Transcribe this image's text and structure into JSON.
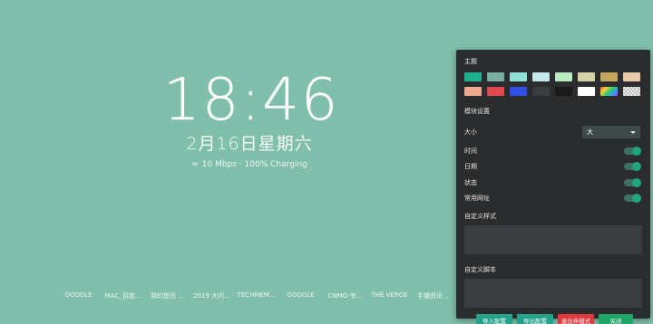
{
  "clock": {
    "time": "18:46",
    "date": "2月16日星期六",
    "status": "10 Mbps · 100% Charging",
    "wifi_icon": "≈"
  },
  "bookmarks": [
    "GOOGLE",
    "MAC_百度...",
    "我的首页 ...",
    "2019 大内...",
    "TECHMEM...",
    "GOOGLE",
    "CNMO-专...",
    "THE VERGE",
    "手機资讯 ..."
  ],
  "panel": {
    "theme_title": "主题",
    "swatches": [
      "#1fb18e",
      "#79b0a0",
      "#8fe0d6",
      "#c4e7ea",
      "#b9ebbf",
      "#d7d1a7",
      "#c7a660",
      "#e6c9a6",
      "#f0a98e",
      "#e04950",
      "#2f4fe4",
      "#3a3c3d",
      "#1a1a1a",
      "#ffffff",
      "rainbow",
      "checker"
    ],
    "module_title": "模块设置",
    "size_label": "大小",
    "size_value": "大",
    "toggles": [
      {
        "label": "时间",
        "on": true
      },
      {
        "label": "日期",
        "on": true
      },
      {
        "label": "状态",
        "on": true
      },
      {
        "label": "常用网址",
        "on": true
      }
    ],
    "custom_style_label": "自定义样式",
    "custom_script_label": "自定义脚本",
    "buttons": {
      "import": "导入配置",
      "export": "导出配置",
      "exit": "退出伴模式",
      "close": "关闭"
    }
  }
}
